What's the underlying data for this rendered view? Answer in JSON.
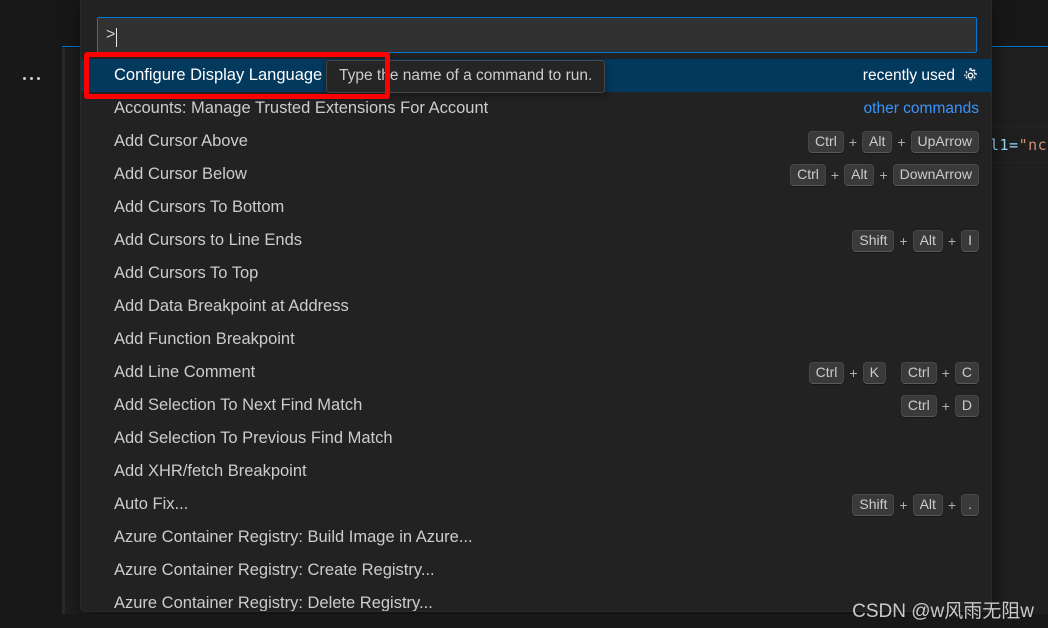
{
  "window": {
    "background_color": "#1f1f1f",
    "activitybar": {
      "more_icon": "ellipsis-icon"
    },
    "editor_code_fragment": {
      "attr": "l1=",
      "op": "=",
      "quote": "\"",
      "value": "nc"
    }
  },
  "quick_input": {
    "search": {
      "value": ">",
      "placeholder": "Type the name of a command to run."
    },
    "tooltip": "Type the name of a command to run.",
    "groups": {
      "recently_used": "recently used",
      "other_commands": "other commands",
      "gear_icon": "gear-icon"
    },
    "items": [
      {
        "label": "Configure Display Language",
        "selected": true,
        "group": "recently used",
        "keys": []
      },
      {
        "label": "Accounts: Manage Trusted Extensions For Account",
        "selected": false,
        "group": "other commands",
        "keys": []
      },
      {
        "label": "Add Cursor Above",
        "selected": false,
        "group": "",
        "keys": [
          [
            "Ctrl",
            "Alt",
            "UpArrow"
          ]
        ]
      },
      {
        "label": "Add Cursor Below",
        "selected": false,
        "group": "",
        "keys": [
          [
            "Ctrl",
            "Alt",
            "DownArrow"
          ]
        ]
      },
      {
        "label": "Add Cursors To Bottom",
        "selected": false,
        "group": "",
        "keys": []
      },
      {
        "label": "Add Cursors to Line Ends",
        "selected": false,
        "group": "",
        "keys": [
          [
            "Shift",
            "Alt",
            "I"
          ]
        ]
      },
      {
        "label": "Add Cursors To Top",
        "selected": false,
        "group": "",
        "keys": []
      },
      {
        "label": "Add Data Breakpoint at Address",
        "selected": false,
        "group": "",
        "keys": []
      },
      {
        "label": "Add Function Breakpoint",
        "selected": false,
        "group": "",
        "keys": []
      },
      {
        "label": "Add Line Comment",
        "selected": false,
        "group": "",
        "keys": [
          [
            "Ctrl",
            "K"
          ],
          [
            "Ctrl",
            "C"
          ]
        ]
      },
      {
        "label": "Add Selection To Next Find Match",
        "selected": false,
        "group": "",
        "keys": [
          [
            "Ctrl",
            "D"
          ]
        ]
      },
      {
        "label": "Add Selection To Previous Find Match",
        "selected": false,
        "group": "",
        "keys": []
      },
      {
        "label": "Add XHR/fetch Breakpoint",
        "selected": false,
        "group": "",
        "keys": []
      },
      {
        "label": "Auto Fix...",
        "selected": false,
        "group": "",
        "keys": [
          [
            "Shift",
            "Alt",
            "."
          ]
        ]
      },
      {
        "label": "Azure Container Registry: Build Image in Azure...",
        "selected": false,
        "group": "",
        "keys": []
      },
      {
        "label": "Azure Container Registry: Create Registry...",
        "selected": false,
        "group": "",
        "keys": []
      },
      {
        "label": "Azure Container Registry: Delete Registry...",
        "selected": false,
        "group": "",
        "keys": []
      }
    ]
  },
  "annotation": {
    "color": "#fe0000",
    "target": "Configure Display Language"
  },
  "watermark": {
    "text": "CSDN @w风雨无阻w"
  }
}
